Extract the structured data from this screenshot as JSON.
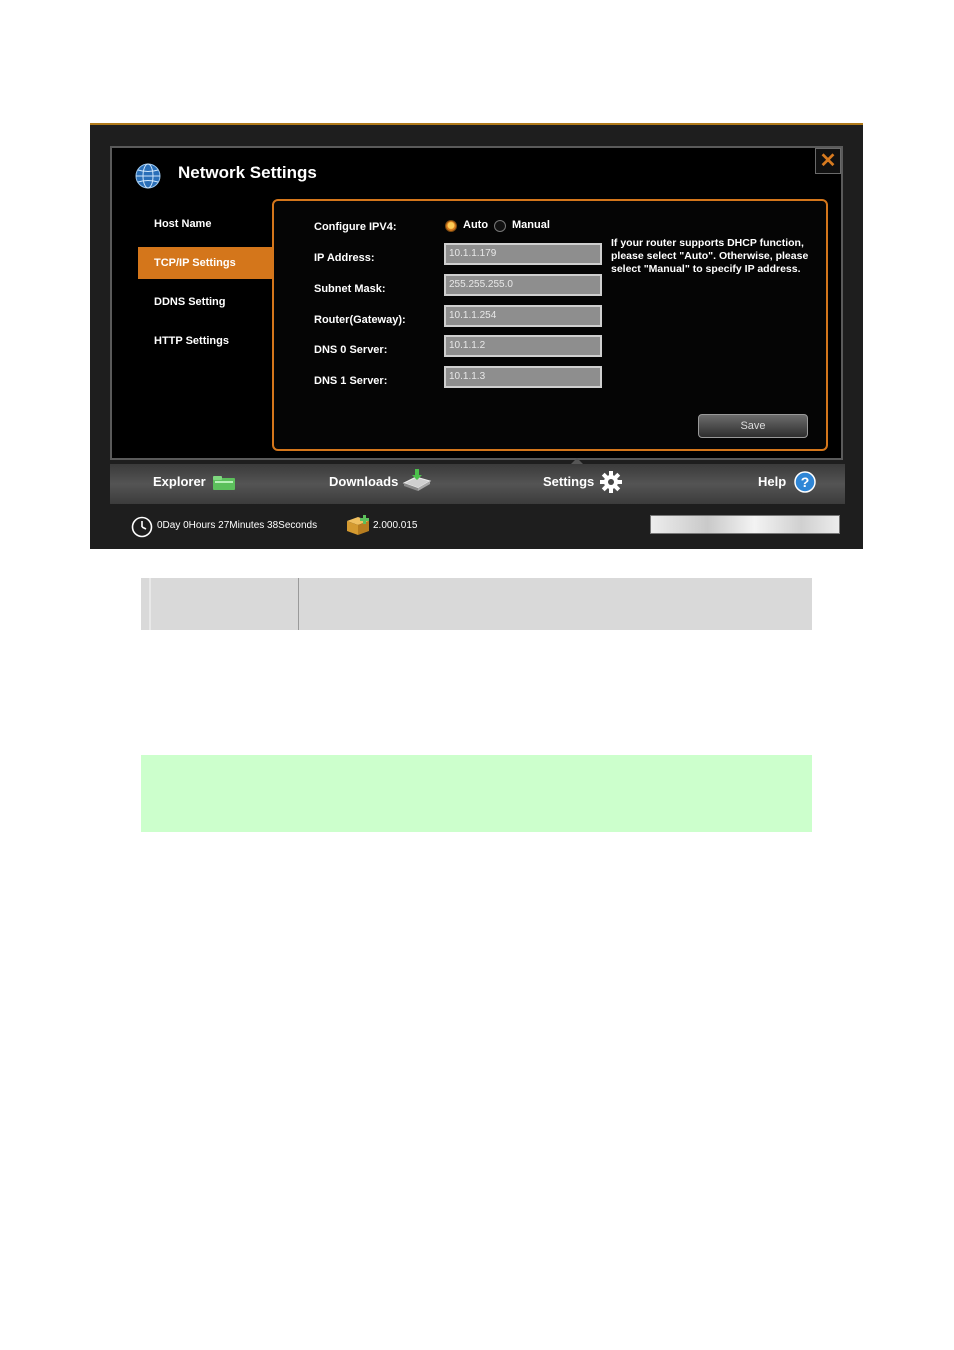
{
  "window": {
    "title": "Network Settings",
    "close_label": "✕"
  },
  "sidebar": {
    "items": [
      {
        "label": "Host Name"
      },
      {
        "label": "TCP/IP Settings"
      },
      {
        "label": "DDNS Setting"
      },
      {
        "label": "HTTP Settings"
      }
    ],
    "active_index": 1
  },
  "form": {
    "configure_label": "Configure IPV4:",
    "mode_auto": "Auto",
    "mode_manual": "Manual",
    "selected_mode": "Auto",
    "ip_label": "IP Address:",
    "ip_value": "10.1.1.179",
    "mask_label": "Subnet Mask:",
    "mask_value": "255.255.255.0",
    "gateway_label": "Router(Gateway):",
    "gateway_value": "10.1.1.254",
    "dns0_label": "DNS 0 Server:",
    "dns0_value": "10.1.1.2",
    "dns1_label": "DNS 1 Server:",
    "dns1_value": "10.1.1.3",
    "hint": "If your router supports DHCP function, please select \"Auto\". Otherwise, please select \"Manual\" to specify IP address.",
    "save_label": "Save"
  },
  "tabbar": {
    "explorer": "Explorer",
    "downloads": "Downloads",
    "settings": "Settings",
    "help": "Help",
    "active": "Settings"
  },
  "status": {
    "uptime": "0Day 0Hours 27Minutes 38Seconds",
    "version": "2.000.015"
  },
  "colors": {
    "accent": "#d4761b",
    "dialog_bg": "#000000",
    "green_box": "#ccffcc",
    "gray_table": "#d9d9d9"
  }
}
